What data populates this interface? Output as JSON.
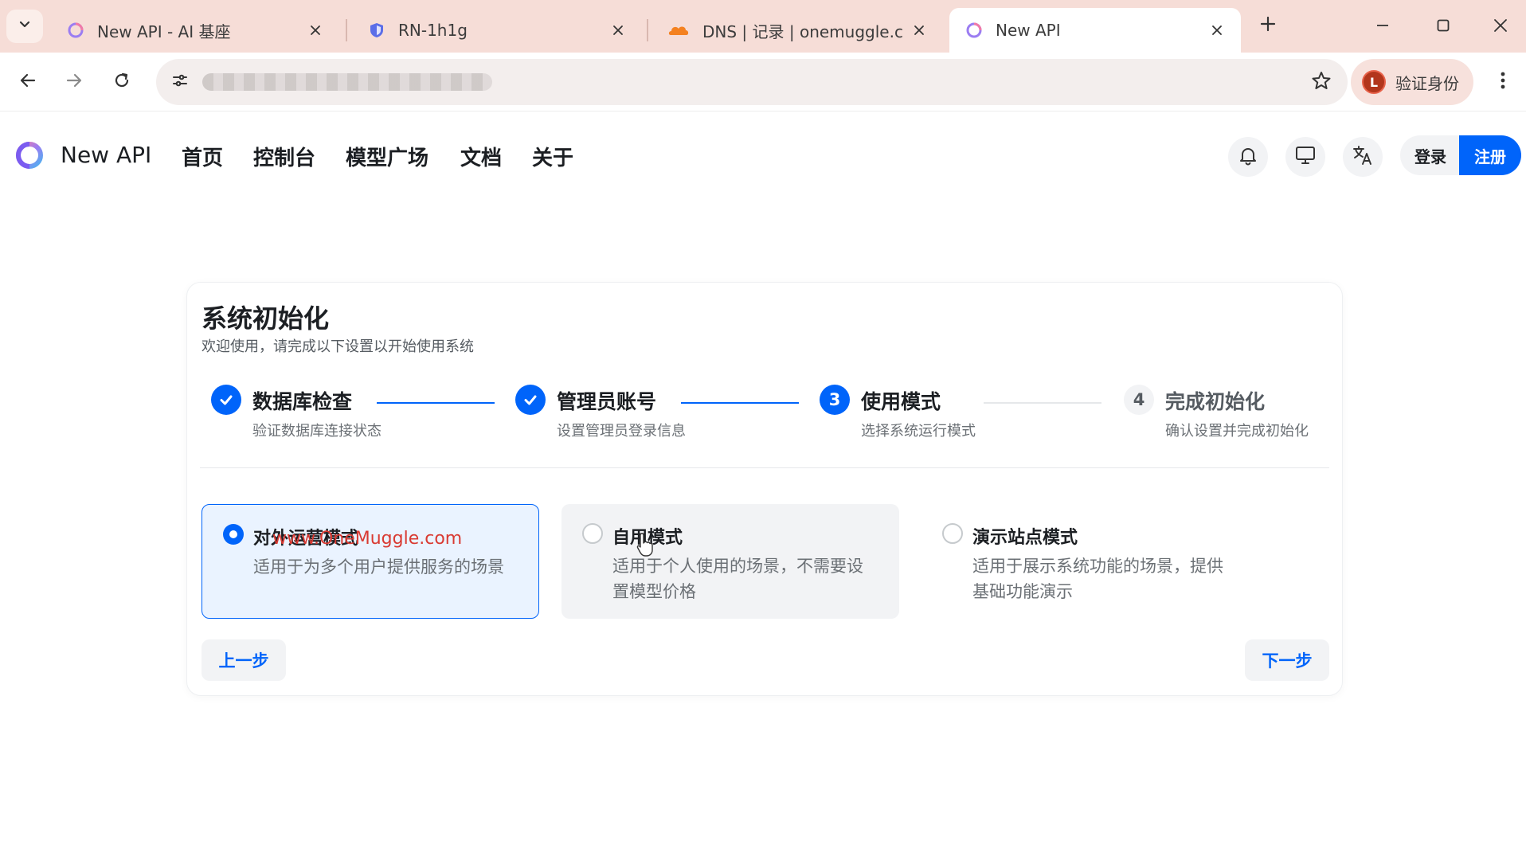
{
  "browser": {
    "tabs": [
      {
        "title": "New API - AI 基座",
        "active": false,
        "favicon": "new-api-logo-icon"
      },
      {
        "title": "RN-1h1g",
        "active": false,
        "favicon": "shield-icon"
      },
      {
        "title": "DNS | 记录 | onemuggle.com",
        "active": false,
        "favicon": "cloudflare-icon"
      },
      {
        "title": "New API",
        "active": true,
        "favicon": "new-api-logo-icon"
      }
    ],
    "profile_label": "验证身份",
    "profile_initial": "L"
  },
  "header": {
    "brand": "New API",
    "nav": [
      "首页",
      "控制台",
      "模型广场",
      "文档",
      "关于"
    ],
    "login_label": "登录",
    "register_label": "注册",
    "icons": [
      "bell-icon",
      "monitor-icon",
      "translate-icon"
    ]
  },
  "setup": {
    "title": "系统初始化",
    "subtitle": "欢迎使用，请完成以下设置以开始使用系统",
    "steps": [
      {
        "title": "数据库检查",
        "desc": "验证数据库连接状态",
        "status": "done"
      },
      {
        "title": "管理员账号",
        "desc": "设置管理员登录信息",
        "status": "done"
      },
      {
        "number": "3",
        "title": "使用模式",
        "desc": "选择系统运行模式",
        "status": "current"
      },
      {
        "number": "4",
        "title": "完成初始化",
        "desc": "确认设置并完成初始化",
        "status": "wait"
      }
    ],
    "options": [
      {
        "title": "对外运营模式",
        "desc": "适用于为多个用户提供服务的场景",
        "selected": true
      },
      {
        "title": "自用模式",
        "desc": "适用于个人使用的场景，不需要设置模型价格",
        "selected": false
      },
      {
        "title": "演示站点模式",
        "desc": "适用于展示系统功能的场景，提供基础功能演示",
        "selected": false
      }
    ],
    "prev_label": "上一步",
    "next_label": "下一步"
  },
  "watermark": "www.OneMuggle.com",
  "colors": {
    "primary": "#0064fa",
    "tabbar": "#f6ddd7",
    "selected_bg": "#eaf3ff",
    "watermark": "#d93a32"
  }
}
